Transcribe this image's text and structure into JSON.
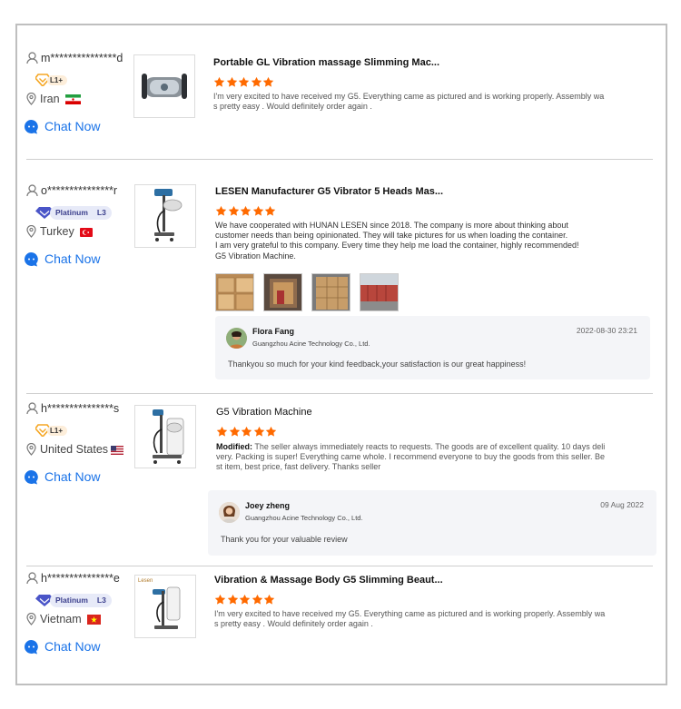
{
  "reviews": [
    {
      "buyer": {
        "name": "m***************d",
        "level": "L1+",
        "level_type": "l1",
        "country": "Iran",
        "flag": "iran"
      },
      "chat_label": "Chat Now",
      "product_title": "Portable GL Vibration massage  Slimming Mac...",
      "rating": 5,
      "text_lines": [
        "I'm very excited to have received my G5. Everything came as pictured and is working properly. Assembly wa",
        "s pretty easy . Would definitely order again ."
      ],
      "photos": []
    },
    {
      "buyer": {
        "name": "o***************r",
        "level_name": "Platinum",
        "level": "L3",
        "level_type": "platinum",
        "country": "Turkey",
        "flag": "turkey"
      },
      "chat_label": "Chat Now",
      "product_title": "LESEN Manufacturer G5 Vibrator 5 Heads Mas...",
      "rating": 5,
      "text_lines": [
        "We have cooperated with HUNAN LESEN since 2018. The company is more about thinking about",
        "customer needs than being opinionated. They will take pictures for us when loading the container.",
        "I am very grateful to this company. Every time they help me load the container, highly recommended!",
        "G5 Vibration Machine."
      ],
      "photos": [
        "boxes-photo-1",
        "container-photo",
        "boxes-photo-2",
        "truck-photo"
      ],
      "reply": {
        "name": "Flora Fang",
        "company": "Guangzhou Acine Technology Co., Ltd.",
        "date": "2022-08-30 23:21",
        "text": "Thankyou so much for your kind feedback,your satisfaction is our great happiness!"
      }
    },
    {
      "buyer": {
        "name": "h***************s",
        "level": "L1+",
        "level_type": "l1",
        "country": "United States",
        "flag": "usa"
      },
      "chat_label": "Chat Now",
      "product_title": "G5 Vibration Machine",
      "rating": 5,
      "modified_label": "Modified:",
      "text_lines": [
        " The seller always immediately reacts to requests. The goods are of excellent quality. 10 days deli",
        "very. Packing is super! Everything came whole. I recommend everyone to buy the goods from this seller. Be",
        "st item, best price, fast delivery. Thanks seller"
      ],
      "photos": [],
      "reply": {
        "name": "Joey zheng",
        "company": "Guangzhou Acine Technology Co., Ltd.",
        "date": "09 Aug 2022",
        "text": "Thank you for your valuable review"
      }
    },
    {
      "buyer": {
        "name": "h***************e",
        "level_name": "Platinum",
        "level": "L3",
        "level_type": "platinum",
        "country": "Vietnam",
        "flag": "vietnam"
      },
      "chat_label": "Chat Now",
      "product_title": "Vibration & Massage Body G5 Slimming Beaut...",
      "rating": 5,
      "text_lines": [
        "I'm very excited to have received my G5. Everything came as pictured and is working properly. Assembly wa",
        "s pretty easy . Would definitely order again ."
      ],
      "photos": [],
      "thumb_logo": "Lesen"
    }
  ],
  "colors": {
    "star": "#ff6a00",
    "chat": "#1a73e8",
    "badge_orange": "#f5a623",
    "platinum": "#4a55c8"
  },
  "icons": {
    "user": "user-outline-icon",
    "pin": "location-pin-icon",
    "chat": "chat-bubble-icon",
    "star": "star-icon"
  }
}
